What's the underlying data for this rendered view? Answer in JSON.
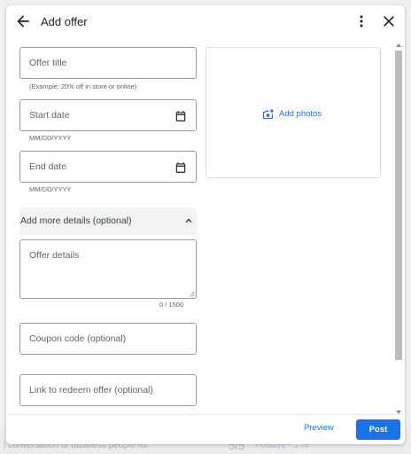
{
  "dialog": {
    "title": "Add offer"
  },
  "form": {
    "offer_title": {
      "placeholder": "Offer title",
      "hint": "(Example: 20% off in store or online)"
    },
    "start_date": {
      "placeholder": "Start date",
      "hint": "MM/DD/YYYY"
    },
    "end_date": {
      "placeholder": "End date",
      "hint": "MM/DD/YYYY"
    },
    "details_toggle": {
      "label": "Add more details (optional)",
      "icon": "chevron-up-icon"
    },
    "offer_details": {
      "placeholder": "Offer details",
      "counter": "0 / 1500"
    },
    "coupon_code": {
      "placeholder": "Coupon code (optional)"
    },
    "redeem_link": {
      "placeholder": "Link to redeem offer (optional)"
    }
  },
  "photos": {
    "label": "Add photos",
    "icon": "add-photo-icon"
  },
  "footer": {
    "preview_label": "Preview",
    "post_label": "Post"
  },
  "icons": {
    "back": "arrow-back-icon",
    "more": "more-vert-icon",
    "close": "close-icon",
    "calendar": "calendar-icon"
  },
  "background": {
    "footer_text": "| conversation or business people for",
    "rating": "5/5",
    "link_text": "Positive · 1 hr"
  },
  "colors": {
    "accent": "#1a73e8",
    "text": "#202124",
    "secondary_text": "#5f6368",
    "border": "#9a9a9a"
  }
}
